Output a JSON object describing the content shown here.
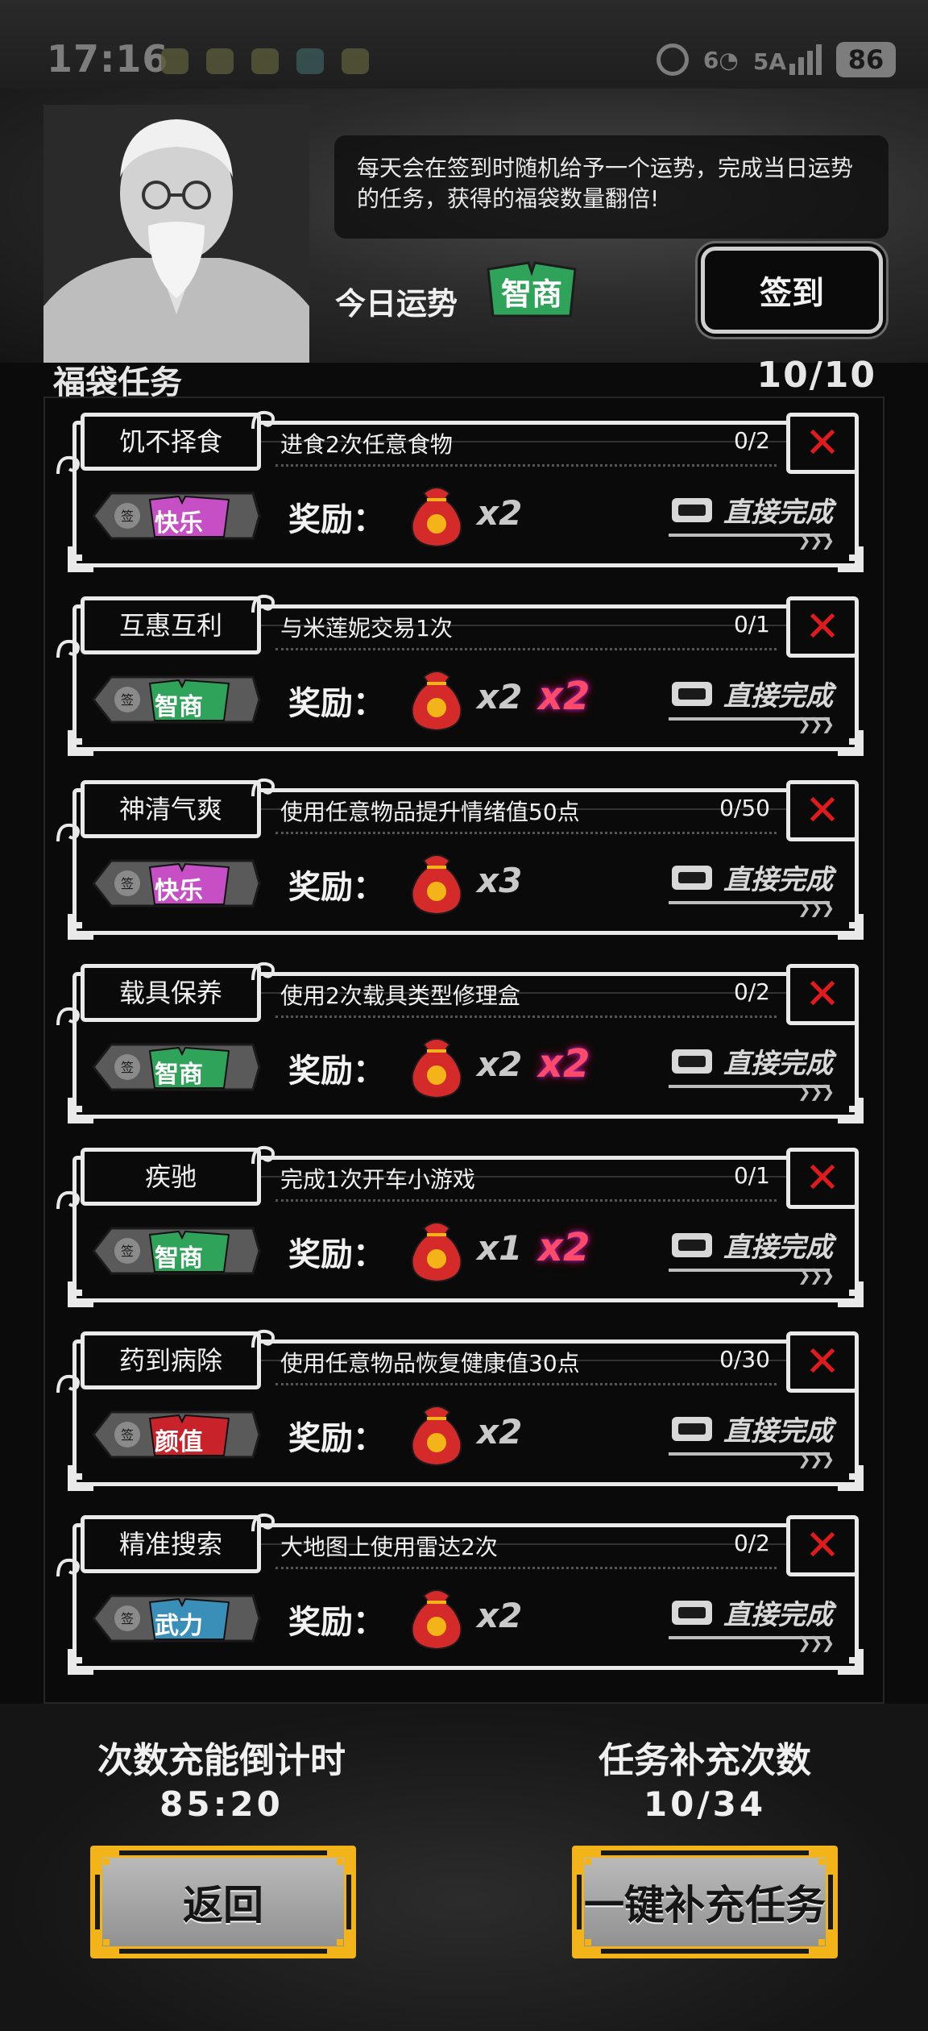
{
  "status_bar": {
    "time": "17:16",
    "wifi": "6",
    "signal": "5A",
    "battery": "86"
  },
  "header": {
    "description": "每天会在签到时随机给予一个运势，完成当日运势的任务，获得的福袋数量翻倍!",
    "fortune_label": "今日运势",
    "fortune_value": "智商",
    "signin_label": "签到"
  },
  "section": {
    "title": "福袋任务",
    "count": "10/10"
  },
  "reward_label": "奖励：",
  "direct_complete_label": "直接完成",
  "tasks": [
    {
      "name": "饥不择食",
      "goal": "进食2次任意食物",
      "progress": "0/2",
      "tag": "快乐",
      "tag_color": "#c64fc6",
      "multiplier": "x2",
      "bonus": ""
    },
    {
      "name": "互惠互利",
      "goal": "与米莲妮交易1次",
      "progress": "0/1",
      "tag": "智商",
      "tag_color": "#2fa35a",
      "multiplier": "x2",
      "bonus": "x2"
    },
    {
      "name": "神清气爽",
      "goal": "使用任意物品提升情绪值50点",
      "progress": "0/50",
      "tag": "快乐",
      "tag_color": "#c64fc6",
      "multiplier": "x3",
      "bonus": ""
    },
    {
      "name": "载具保养",
      "goal": "使用2次载具类型修理盒",
      "progress": "0/2",
      "tag": "智商",
      "tag_color": "#2fa35a",
      "multiplier": "x2",
      "bonus": "x2"
    },
    {
      "name": "疾驰",
      "goal": "完成1次开车小游戏",
      "progress": "0/1",
      "tag": "智商",
      "tag_color": "#2fa35a",
      "multiplier": "x1",
      "bonus": "x2"
    },
    {
      "name": "药到病除",
      "goal": "使用任意物品恢复健康值30点",
      "progress": "0/30",
      "tag": "颜值",
      "tag_color": "#c8222a",
      "multiplier": "x2",
      "bonus": ""
    },
    {
      "name": "精准搜索",
      "goal": "大地图上使用雷达2次",
      "progress": "0/2",
      "tag": "武力",
      "tag_color": "#3a8fb8",
      "multiplier": "x2",
      "bonus": ""
    }
  ],
  "footer": {
    "countdown_label": "次数充能倒计时",
    "countdown_value": "85:20",
    "refill_label": "任务补充次数",
    "refill_value": "10/34",
    "back_label": "返回",
    "refill_button_label": "一键补充任务"
  },
  "colors": {
    "gold": "#f2b418",
    "close_red": "#e11b1b",
    "bonus_pink": "#ff4a6a"
  }
}
